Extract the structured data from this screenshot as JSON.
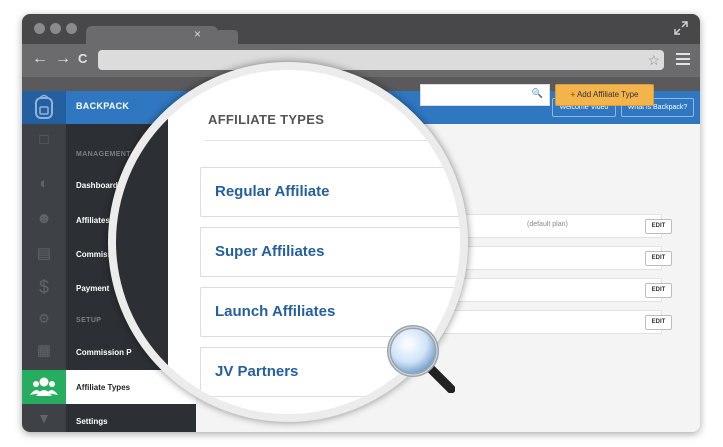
{
  "browser": {
    "tab_close": "×",
    "nav": {
      "back": "←",
      "forward": "→",
      "reload": "C"
    },
    "bookmark_glyph": "☆"
  },
  "app": {
    "brand": "BACKPACK",
    "header_buttons": [
      "Welcome Video",
      "What is Backpack?"
    ],
    "sidebar": {
      "section_management": "MANAGEMENT",
      "section_setup": "SETUP",
      "items": {
        "dashboard": "Dashboard",
        "affiliates": "Affiliates",
        "commissions": "Commiss",
        "payments": "Payment",
        "commission_plans": "Commission P",
        "affiliate_types": "Affiliate Types",
        "settings": "Settings"
      }
    },
    "content": {
      "add_button": "Add Affiliate Type",
      "add_icon": "+",
      "search_icon": "🔍",
      "default_plan": "(default plan)",
      "edit_label": "EDIT"
    }
  },
  "magnified": {
    "title": "AFFILIATE TYPES",
    "cards": [
      "Regular Affiliate",
      "Super Affiliates",
      "Launch Affiliates",
      "JV Partners"
    ]
  },
  "colors": {
    "brand_blue": "#2f77c1",
    "active_green": "#27ad5f",
    "add_orange": "#f3b44c",
    "link_blue": "#25609e"
  }
}
